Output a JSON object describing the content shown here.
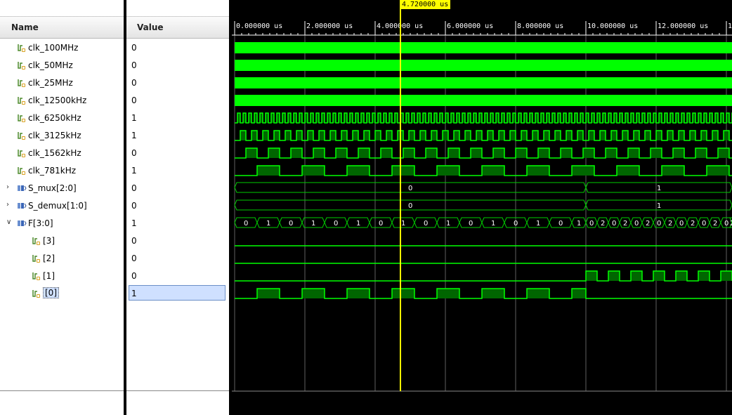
{
  "columns": {
    "name_header": "Name",
    "value_header": "Value"
  },
  "colors": {
    "wave": "#00ff00",
    "wave_fill": "#006600",
    "bus_line": "#00cc00",
    "cursor": "#ffff00",
    "grid": "#606060"
  },
  "timeline": {
    "unit": "us",
    "ticks": [
      "0.000000 us",
      "2.000000 us",
      "4.000000 us",
      "6.000000 us",
      "8.000000 us",
      "10.000000 us",
      "12.000000 us",
      "1"
    ],
    "cursor_label": "4.720000 us",
    "cursor_time": 4.72
  },
  "signals": [
    {
      "name": "clk_100MHz",
      "value": "0",
      "kind": "bit",
      "icon": "signal-icon",
      "wave": "solid"
    },
    {
      "name": "clk_50MHz",
      "value": "0",
      "kind": "bit",
      "icon": "signal-icon",
      "wave": "solid"
    },
    {
      "name": "clk_25MHz",
      "value": "0",
      "kind": "bit",
      "icon": "signal-icon",
      "wave": "solid"
    },
    {
      "name": "clk_12500kHz",
      "value": "0",
      "kind": "bit",
      "icon": "signal-icon",
      "wave": "solid"
    },
    {
      "name": "clk_6250kHz",
      "value": "1",
      "kind": "bit",
      "icon": "signal-icon",
      "wave": "clock",
      "period_us": 0.16
    },
    {
      "name": "clk_3125kHz",
      "value": "1",
      "kind": "bit",
      "icon": "signal-icon",
      "wave": "clock",
      "period_us": 0.32
    },
    {
      "name": "clk_1562kHz",
      "value": "0",
      "kind": "bit",
      "icon": "signal-icon",
      "wave": "clock",
      "period_us": 0.64
    },
    {
      "name": "clk_781kHz",
      "value": "1",
      "kind": "bit",
      "icon": "signal-icon",
      "wave": "clock",
      "period_us": 1.28
    },
    {
      "name": "S_mux[2:0]",
      "value": "0",
      "kind": "bus",
      "icon": "bus-icon",
      "expandable": true,
      "expanded": false,
      "segments": [
        {
          "from": 0,
          "to": 10,
          "label": "0"
        },
        {
          "from": 10,
          "to": 14.2,
          "label": "1"
        }
      ]
    },
    {
      "name": "S_demux[1:0]",
      "value": "0",
      "kind": "bus",
      "icon": "bus-icon",
      "expandable": true,
      "expanded": false,
      "segments": [
        {
          "from": 0,
          "to": 10,
          "label": "0"
        },
        {
          "from": 10,
          "to": 14.2,
          "label": "1"
        }
      ]
    },
    {
      "name": "F[3:0]",
      "value": "1",
      "kind": "bus",
      "icon": "bus-icon",
      "expandable": true,
      "expanded": true,
      "wave": "fbus"
    },
    {
      "name": "[3]",
      "value": "0",
      "kind": "bit",
      "icon": "signal-icon",
      "child": true,
      "wave": "low"
    },
    {
      "name": "[2]",
      "value": "0",
      "kind": "bit",
      "icon": "signal-icon",
      "child": true,
      "wave": "low"
    },
    {
      "name": "[1]",
      "value": "0",
      "kind": "bit",
      "icon": "signal-icon",
      "child": true,
      "wave": "f1"
    },
    {
      "name": "[0]",
      "value": "1",
      "kind": "bit",
      "icon": "signal-icon",
      "child": true,
      "selected": true,
      "wave": "f0"
    }
  ],
  "fbus_labels_first": [
    "0",
    "1",
    "0",
    "1",
    "0",
    "1",
    "0",
    "1",
    "0",
    "1",
    "0",
    "1",
    "0",
    "1",
    "0",
    "1"
  ],
  "fbus_labels_second": [
    "0",
    "2",
    "0",
    "2",
    "0",
    "2",
    "0",
    "2",
    "0",
    "2",
    "0",
    "2",
    "0",
    "2"
  ]
}
